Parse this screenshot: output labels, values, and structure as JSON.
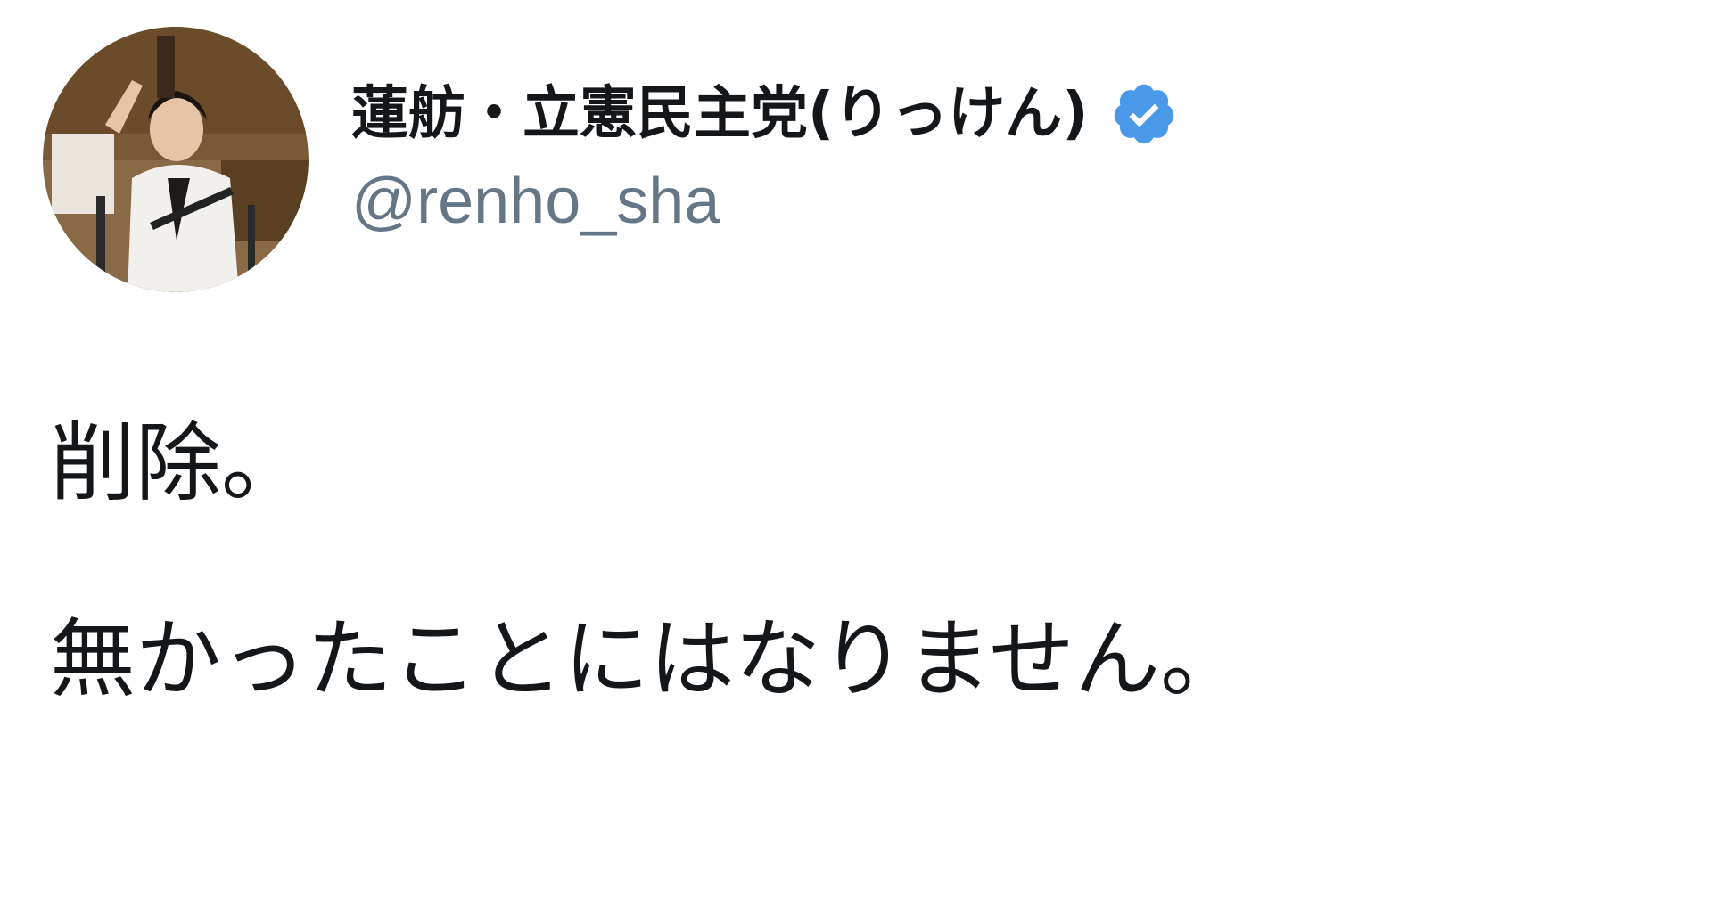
{
  "tweet": {
    "author": {
      "display_name": "蓮舫・立憲民主党(りっけん)",
      "handle": "@renho_sha",
      "verified": true,
      "avatar_icon": "profile-photo",
      "verified_icon": "verified-badge-icon"
    },
    "body": {
      "lines": [
        "削除。",
        "無かったことにはなりません。"
      ]
    }
  },
  "colors": {
    "background": "#ffffff",
    "text_primary": "#14171a",
    "text_secondary": "#657786",
    "verified_blue": "#4a99e9"
  }
}
